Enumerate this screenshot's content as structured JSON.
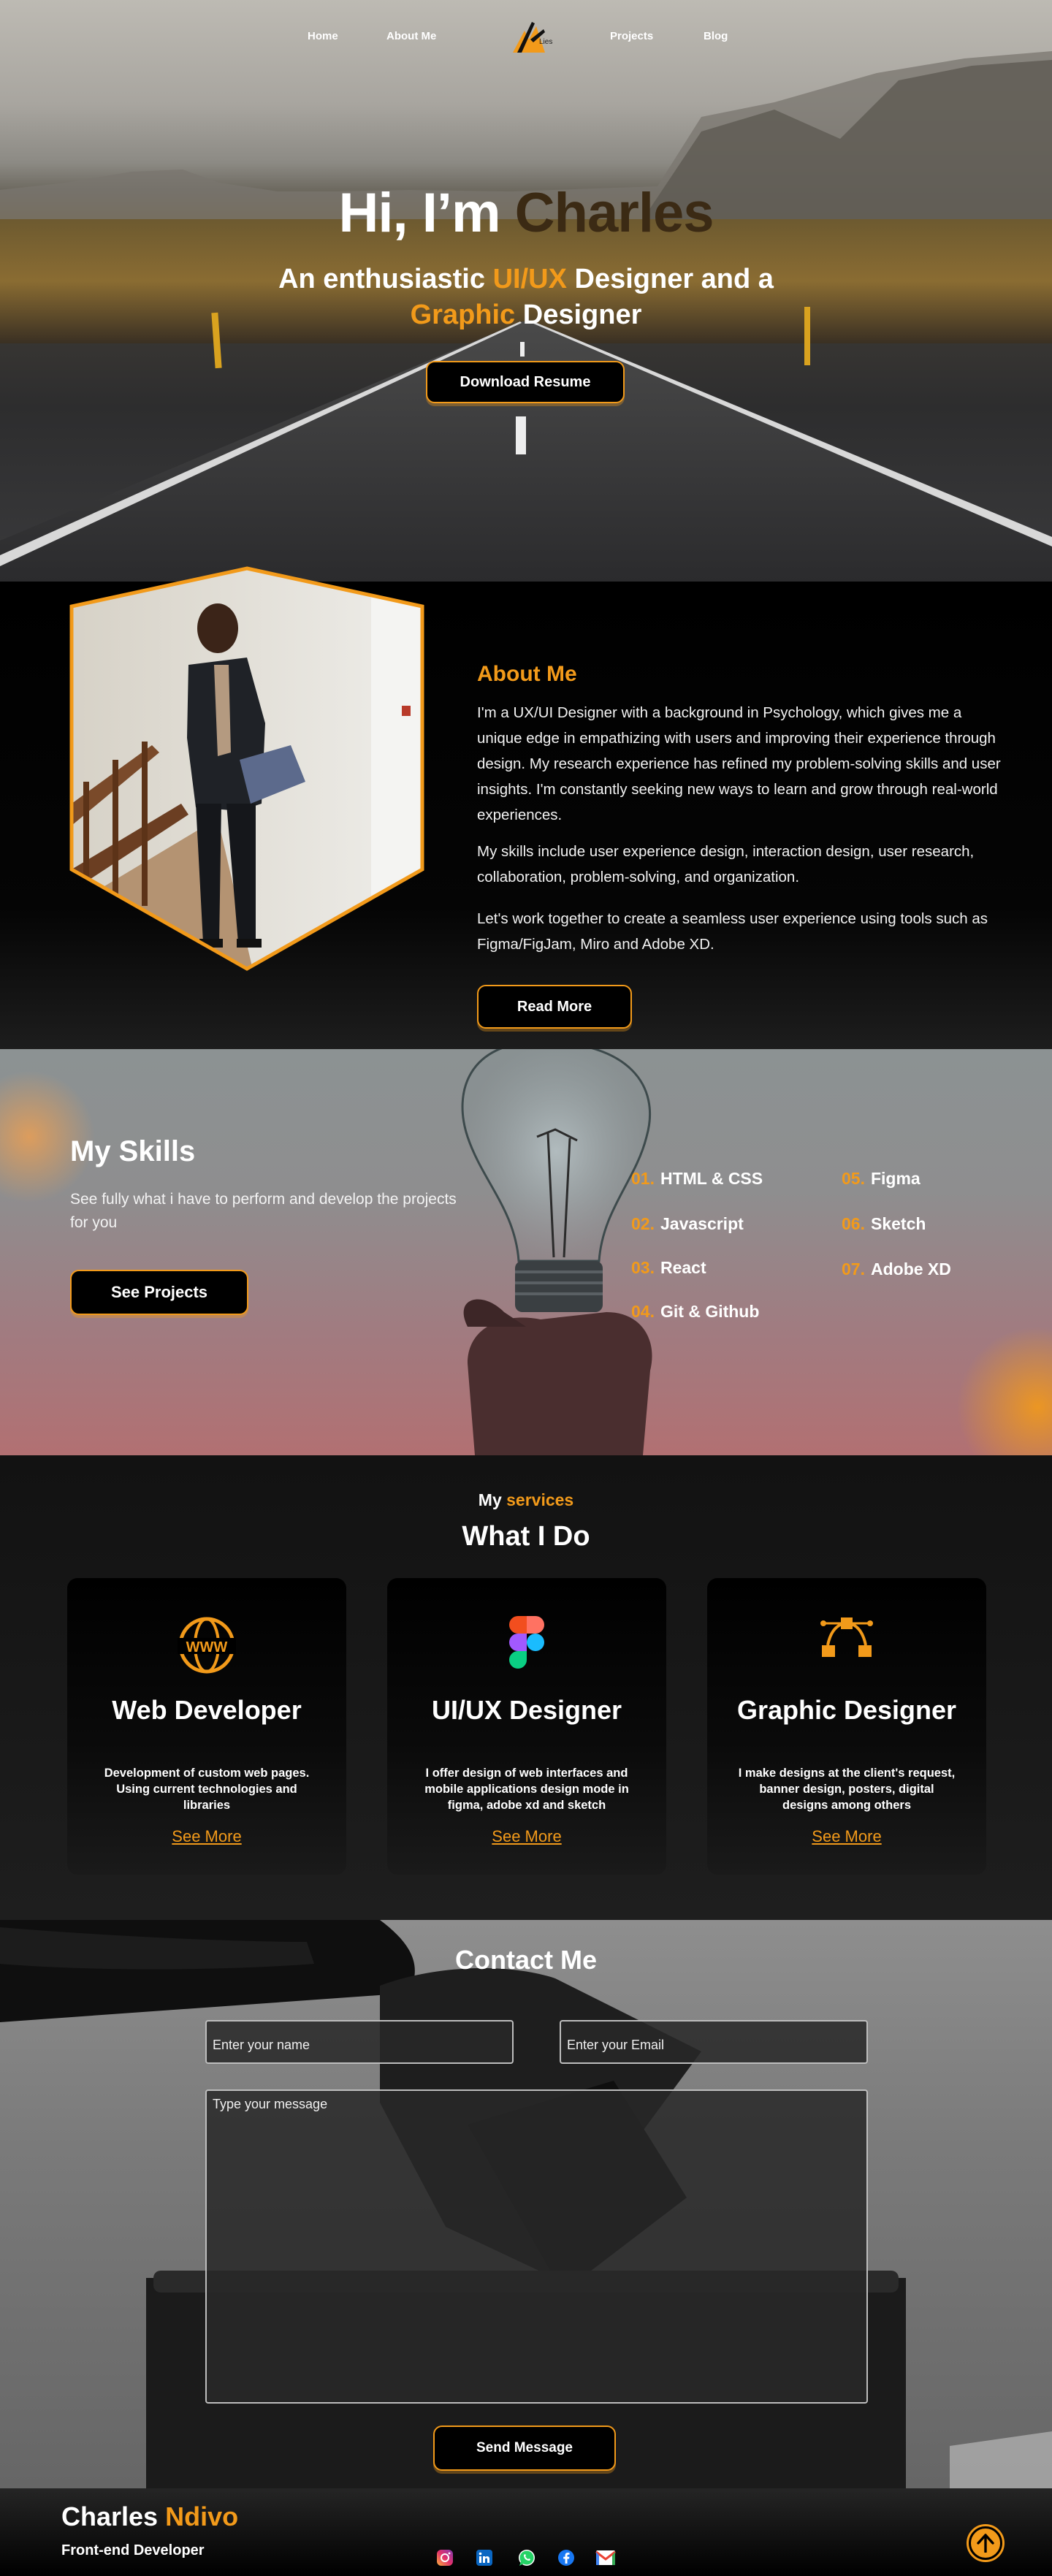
{
  "nav": {
    "items": [
      "Home",
      "About Me",
      "Projects",
      "Blog"
    ],
    "logo_text": "Lies"
  },
  "hero": {
    "greeting": "Hi, I’m",
    "name": "Charles",
    "subtitle_pre": "An enthusiastic",
    "subtitle_accent1": "UI/UX",
    "subtitle_mid": "Designer and  a",
    "subtitle_accent2": "Graphic",
    "subtitle_post": "Designer",
    "button": "Download Resume"
  },
  "about": {
    "title": "About Me",
    "p1": "I'm a UX/UI Designer with a background in Psychology, which gives me a unique edge in empathizing with users and improving their experience through design. My research experience has refined my problem-solving skills and user insights. I'm constantly seeking new ways to learn and grow through real-world experiences.",
    "p2": "My skills include user experience design, interaction design, user research, collaboration, problem-solving, and organization.",
    "p3": "Let's work together to create a seamless user experience using tools such as Figma/FigJam, Miro and Adobe XD.",
    "button": "Read More"
  },
  "skills": {
    "title": "My Skills",
    "description": "See fully what i have to perform and develop the projects for you",
    "button": "See Projects",
    "items": [
      {
        "num": "01.",
        "name": "HTML & CSS"
      },
      {
        "num": "02.",
        "name": "Javascript"
      },
      {
        "num": "03.",
        "name": "React"
      },
      {
        "num": "04.",
        "name": "Git & Github"
      },
      {
        "num": "05.",
        "name": "Figma"
      },
      {
        "num": "06.",
        "name": "Sketch"
      },
      {
        "num": "07.",
        "name": "Adobe XD"
      }
    ]
  },
  "services": {
    "pre": "My",
    "pre_accent": "services",
    "title": "What I Do",
    "cards": [
      {
        "icon": "globe-www-icon",
        "title": "Web Developer",
        "desc": "Development of custom web pages. Using current technologies and libraries",
        "link": "See More"
      },
      {
        "icon": "figma-icon",
        "title": "UI/UX Designer",
        "desc": "I offer design of web interfaces and mobile applications design mode in figma, adobe xd and sketch",
        "link": "See More"
      },
      {
        "icon": "vector-pen-icon",
        "title": "Graphic Designer",
        "desc": "I make designs at the client's request, banner design, posters, digital designs among others",
        "link": "See More"
      }
    ]
  },
  "contact": {
    "title": "Contact Me",
    "name_placeholder": "Enter your name",
    "email_placeholder": "Enter your Email",
    "message_placeholder": "Type your message",
    "button": "Send Message"
  },
  "footer": {
    "first_name": "Charles",
    "last_name": "Ndivo",
    "role": "Front-end Developer",
    "socials": [
      "instagram-icon",
      "linkedin-icon",
      "whatsapp-icon",
      "facebook-icon",
      "gmail-icon"
    ]
  },
  "colors": {
    "accent": "#f29a1a",
    "background": "#000000"
  }
}
